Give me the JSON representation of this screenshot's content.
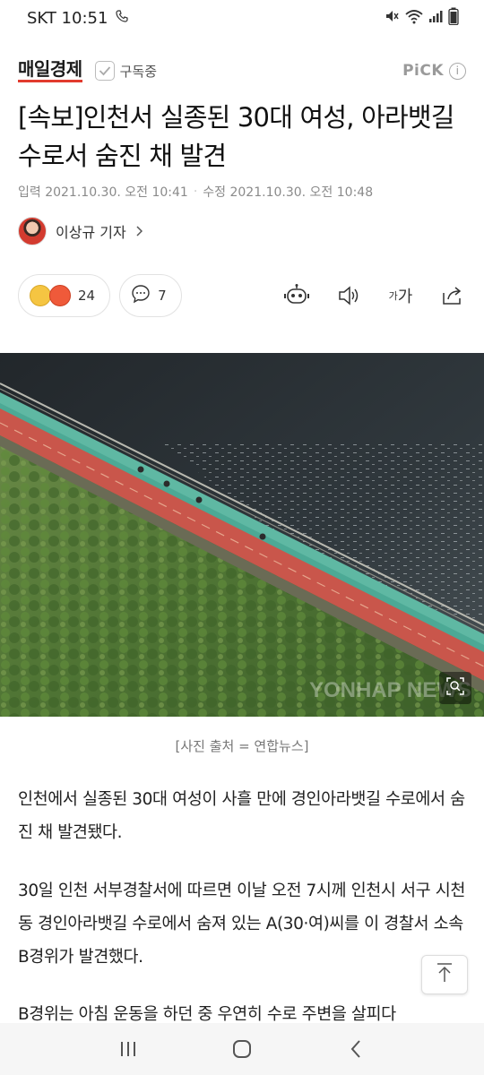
{
  "status_bar": {
    "carrier_time": "SKT 10:51"
  },
  "header": {
    "brand": "매일경제",
    "subscribe_label": "구독중",
    "pick_label": "PiCK",
    "info_glyph": "i"
  },
  "article": {
    "title": "[속보]인천서 실종된 30대 여성, 아라뱃길 수로서 숨진 채 발견",
    "input_date": "입력 2021.10.30. 오전 10:41",
    "modified_date": "수정 2021.10.30. 오전 10:48",
    "reporter": "이상규 기자",
    "photo_caption": "[사진 출처 = 연합뉴스]",
    "watermark": "YONHAP NEWS",
    "paragraphs": [
      "인천에서 실종된 30대 여성이 사흘 만에 경인아라뱃길 수로에서 숨진 채 발견됐다.",
      "30일 인천 서부경찰서에 따르면 이날 오전 7시께 인천시 서구 시천동 경인아라뱃길 수로에서 숨져 있는 A(30·여)씨를 이 경찰서 소속 B경위가 발견했다.",
      "B경위는 아침 운동을 하던 중 우연히 수로 주변을 살피다"
    ]
  },
  "reactions": {
    "emotion_count": "24",
    "comment_count": "7"
  },
  "toolbar": {
    "font_small": "가",
    "font_large": "가"
  },
  "icons": [
    "wifi-icon",
    "battery-icon",
    "check-icon",
    "robot-icon",
    "speaker-icon",
    "share-icon",
    "comment-icon",
    "zoom-icon",
    "scroll-top-icon",
    "recent-apps-icon",
    "home-icon",
    "back-icon"
  ]
}
